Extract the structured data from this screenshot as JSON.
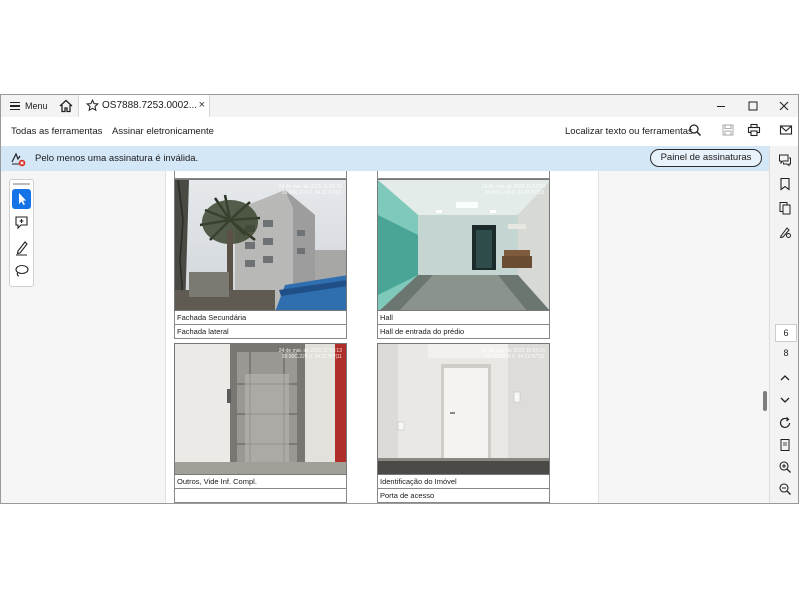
{
  "titlebar": {
    "menu_label": "Menu",
    "tab_title": "OS7888.7253.0002...",
    "tab_close": "×"
  },
  "toolbar": {
    "all_tools": "Todas as ferramentas",
    "sign": "Assinar eletronicamente",
    "find": "Localizar texto ou ferramentas"
  },
  "notification": {
    "message": "Pelo menos uma assinatura é inválida.",
    "panel_button": "Painel de assinaturas"
  },
  "document": {
    "photos": [
      {
        "caption1": "Fachada Secundária",
        "caption2": "Fachada lateral",
        "stamp": "24 de mai. de 2025 11:53:34\n39.90C.224 0, 54.21?6?|11"
      },
      {
        "caption1": "Hall",
        "caption2": "Hall de entrada do prédio",
        "stamp": "24 de mai. de 2025 11:53:54\n39.90C.224 0, 54.21?6?|11"
      },
      {
        "caption1": "Outros, Vide Inf. Compl.",
        "caption2": "",
        "stamp": "24 de mai. de 2025 11:54:13\n39.90C.224 0, 54.21?6?|11"
      },
      {
        "caption1": "Identificação do Imóvel",
        "caption2": "Porta de acesso",
        "stamp": "24 de mai. de 2025 11:54:26\n39.90C.224 0, 54.21?6?|11"
      }
    ]
  },
  "navigation": {
    "current_page": "6",
    "total_pages": "8"
  },
  "colors": {
    "accent": "#1473e6",
    "notification_bg": "#d4e7f7",
    "error": "#d93025"
  }
}
